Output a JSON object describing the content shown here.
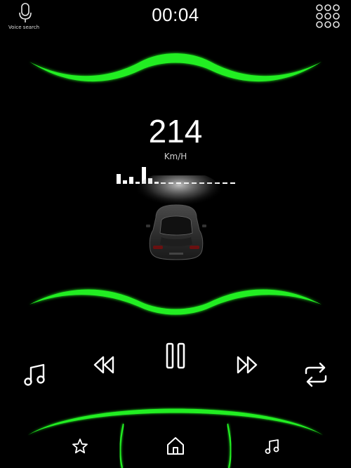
{
  "status_bar": {
    "voice_search_label": "Voice search",
    "time": "00:04",
    "voice_icon": "microphone-icon",
    "apps_icon": "app-grid-icon"
  },
  "dashboard": {
    "speed": "214",
    "unit": "Km/H"
  },
  "media_controls": {
    "music_icon": "music-note-icon",
    "rewind_icon": "rewind-icon",
    "pause_icon": "pause-icon",
    "fast_forward_icon": "fast-forward-icon",
    "repeat_icon": "repeat-icon"
  },
  "bottom_nav": {
    "favorites_icon": "star-icon",
    "home_icon": "home-icon",
    "music_icon": "music-note-icon"
  },
  "colors": {
    "background": "#000000",
    "accent_green": "#22ee22",
    "foreground": "#ffffff"
  }
}
